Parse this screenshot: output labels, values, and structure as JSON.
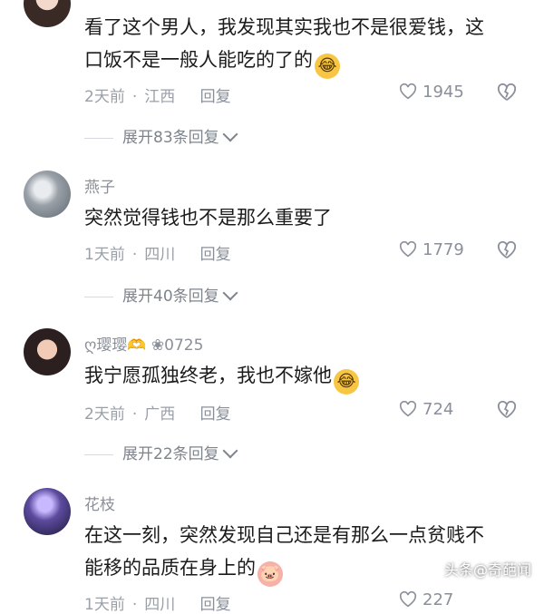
{
  "comments": [
    {
      "username": "",
      "text_line1": "看了这个男人，我发现其实我也不是很爱钱，这",
      "text_line2": "口饭不是一般人能吃的了的",
      "time": "2天前",
      "location": "江西",
      "reply_label": "回复",
      "likes": "1945",
      "expand_label": "展开83条回复"
    },
    {
      "username": "燕子",
      "text_line1": "突然觉得钱也不是那么重要了",
      "time": "1天前",
      "location": "四川",
      "reply_label": "回复",
      "likes": "1779",
      "expand_label": "展开40条回复"
    },
    {
      "username": "ღ璎璎🫶 ❀0725",
      "text_line1": "我宁愿孤独终老，我也不嫁他",
      "time": "2天前",
      "location": "广西",
      "reply_label": "回复",
      "likes": "724",
      "expand_label": "展开22条回复"
    },
    {
      "username": "花枝",
      "text_line1": "在这一刻，突然发现自己还是有那么一点贫贱不",
      "text_line2": "能移的品质在身上的",
      "time": "1天前",
      "location": "四川",
      "reply_label": "回复",
      "likes": "227"
    }
  ],
  "watermark": "头条@奇葩闻",
  "colors": {
    "meta": "#9aa0a8",
    "text": "#1b1b1b"
  }
}
